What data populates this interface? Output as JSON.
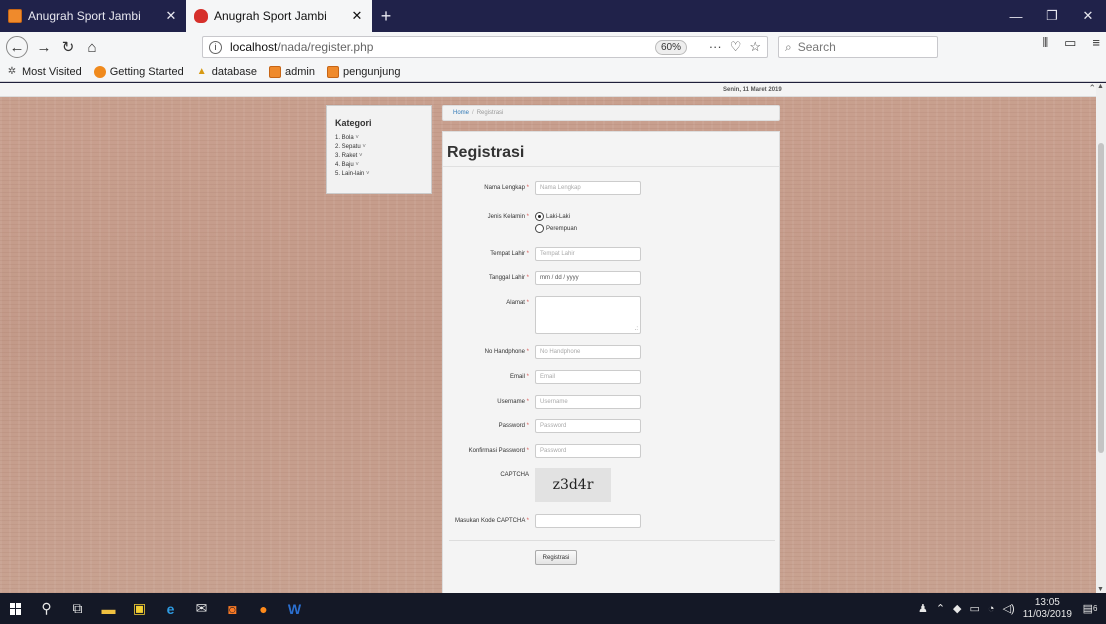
{
  "browser": {
    "tabs": [
      {
        "title": "Anugrah Sport Jambi",
        "active": false
      },
      {
        "title": "Anugrah Sport Jambi",
        "active": true
      }
    ],
    "new_tab": "+",
    "url_host": "localhost",
    "url_path": "/nada/register.php",
    "zoom": "60%",
    "search_placeholder": "Search",
    "bookmarks": [
      "Most Visited",
      "Getting Started",
      "database",
      "admin",
      "pengunjung"
    ]
  },
  "page": {
    "date": "Senin, 11 Maret 2019",
    "kategori": {
      "title": "Kategori",
      "items": [
        "1. Bola",
        "2. Sepatu",
        "3. Raket",
        "4. Baju",
        "5. Lain-lain"
      ]
    },
    "breadcrumb": {
      "home": "Home",
      "sep": "/",
      "current": "Registrasi"
    },
    "form": {
      "heading": "Registrasi",
      "nama_label": "Nama Lengkap",
      "nama_placeholder": "Nama Lengkap",
      "jk_label": "Jenis Kelamin",
      "jk_opt1": "Laki-Laki",
      "jk_opt2": "Perempuan",
      "tempat_label": "Tempat Lahir",
      "tempat_placeholder": "Tempat Lahir",
      "tanggal_label": "Tanggal Lahir",
      "tanggal_value": "mm / dd / yyyy",
      "alamat_label": "Alamat",
      "hp_label": "No Handphone",
      "hp_placeholder": "No Handphone",
      "email_label": "Email",
      "email_placeholder": "Email",
      "username_label": "Username",
      "username_placeholder": "Username",
      "password_label": "Password",
      "password_placeholder": "Password",
      "konf_label": "Konfirmasi Password",
      "konf_placeholder": "Password",
      "captcha_label": "CAPTCHA",
      "captcha_text": "z3d4r",
      "kode_label": "Masukan Kode CAPTCHA",
      "submit_label": "Registrasi",
      "required_mark": "*"
    }
  },
  "taskbar": {
    "time": "13:05",
    "date": "11/03/2019",
    "notifications": "6"
  }
}
